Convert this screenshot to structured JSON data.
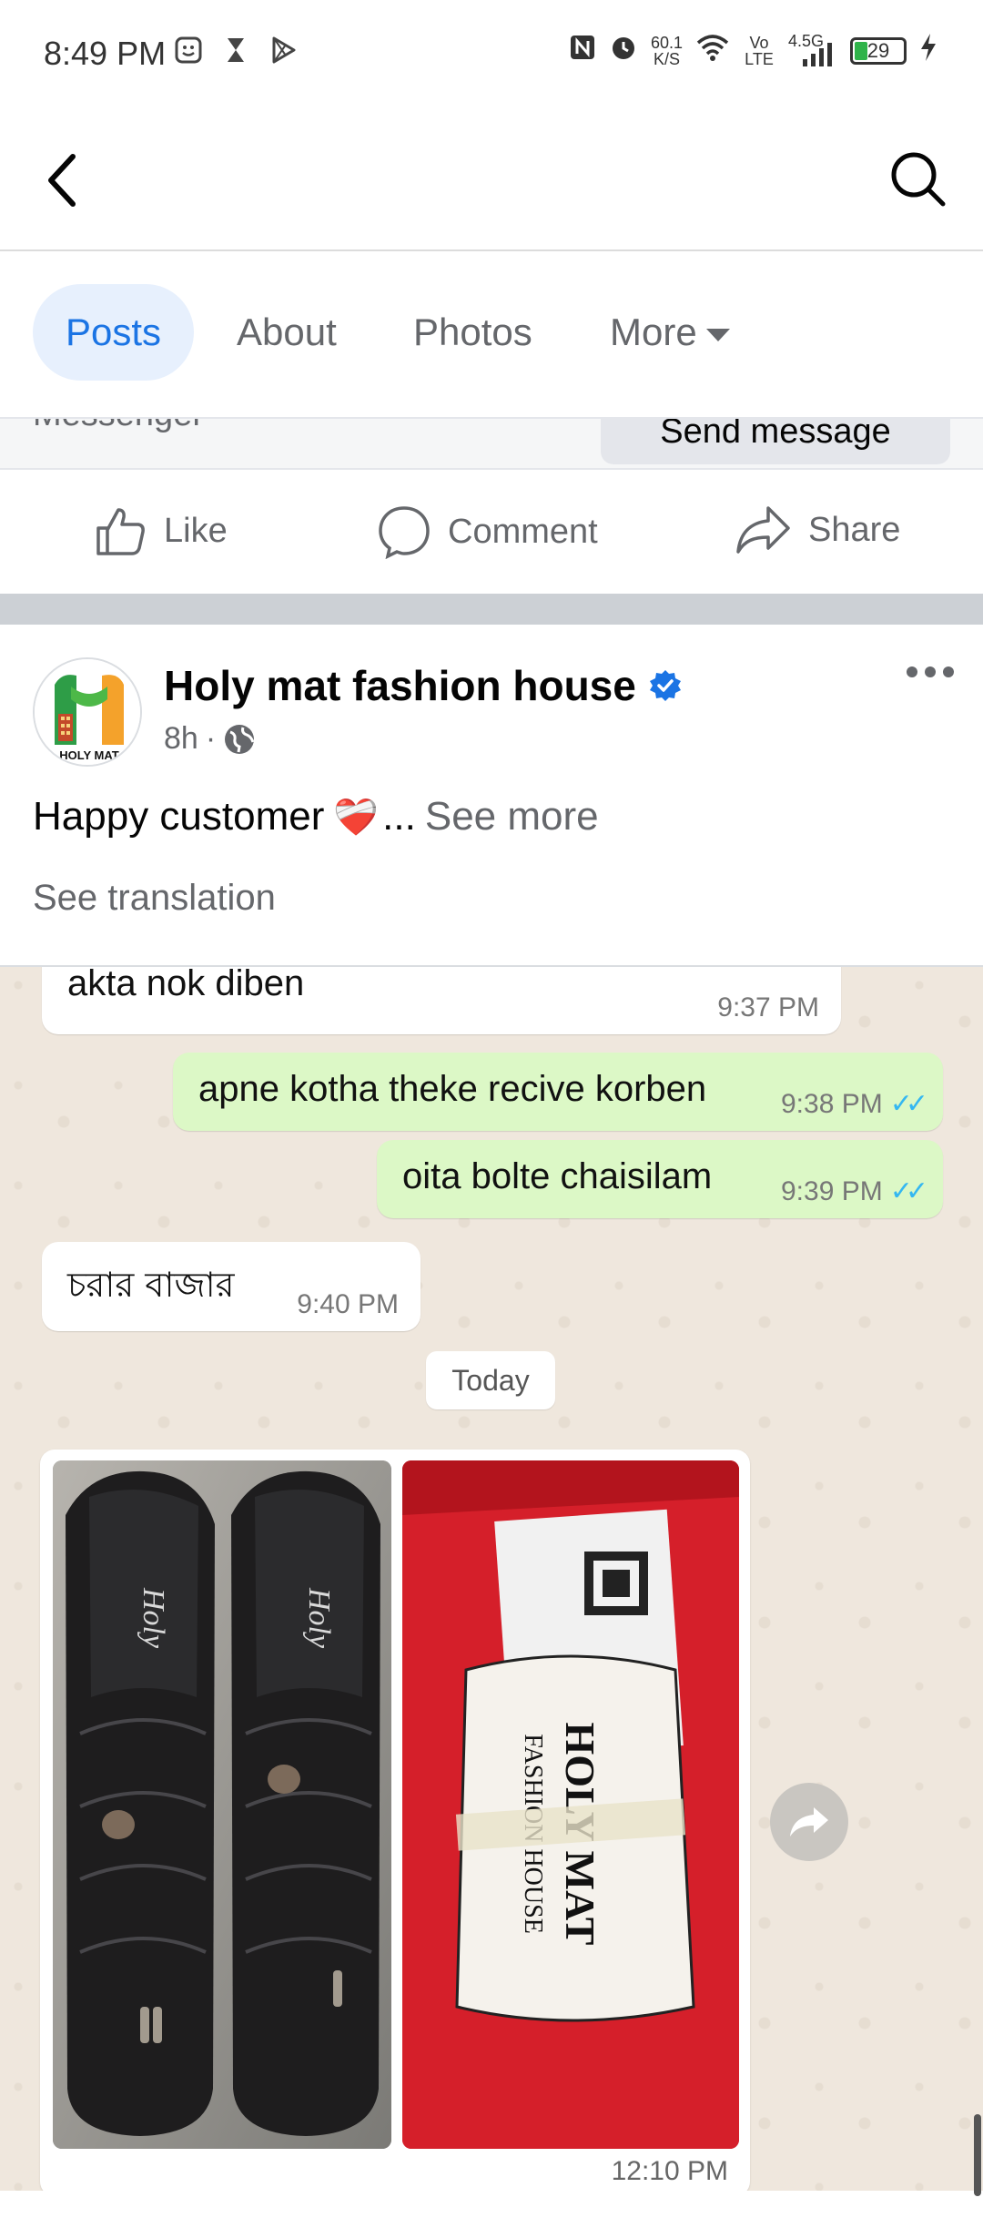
{
  "status_bar": {
    "time": "8:49 PM",
    "speed_value": "60.1",
    "speed_unit": "K/S",
    "volte": "Vo LTE",
    "network": "4.5G",
    "battery": "29"
  },
  "nav": {
    "back_icon": "chevron-left-icon",
    "search_icon": "search-icon"
  },
  "tabs": {
    "items": [
      {
        "label": "Posts"
      },
      {
        "label": "About"
      },
      {
        "label": "Photos"
      },
      {
        "label": "More"
      }
    ]
  },
  "prev_post": {
    "left_text": "Messenger",
    "send_button": "Send message"
  },
  "actions": {
    "like": "Like",
    "comment": "Comment",
    "share": "Share"
  },
  "post": {
    "page_name": "Holy mat fashion house",
    "avatar_text": "HOLY MAT",
    "time_ago": "8h",
    "separator": "·",
    "text": "Happy customer",
    "emoji": "❤️‍🩹",
    "ellipsis": "...",
    "see_more": "See more",
    "see_translation": "See translation"
  },
  "chat": {
    "messages": [
      {
        "text": "akta nok diben",
        "time": "9:37 PM"
      },
      {
        "text": "apne kotha theke recive korben",
        "time": "9:38 PM"
      },
      {
        "text": "oita bolte chaisilam",
        "time": "9:39 PM"
      },
      {
        "text": "চরার বাজার",
        "time": "9:40 PM"
      }
    ],
    "date_chip": "Today",
    "photo_time": "12:10 PM",
    "box_brand_line1": "HOLY MAT",
    "box_brand_line2": "FASHION HOUSE",
    "insole_brand": "Holy"
  },
  "colors": {
    "accent": "#1b74e4",
    "tab_active_bg": "#e7f0fd",
    "secondary_text": "#65676b",
    "outgoing_bubble": "#dcf8c6",
    "chat_bg": "#efe7dd",
    "box_red": "#d51f2a"
  }
}
